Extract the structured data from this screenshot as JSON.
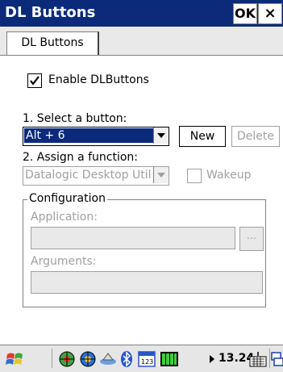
{
  "window": {
    "title": "DL Buttons",
    "ok_label": "OK",
    "close_label": "×"
  },
  "tabs": [
    {
      "label": "DL Buttons"
    }
  ],
  "form": {
    "enable_checkbox": {
      "label": "Enable DLButtons",
      "checked": true
    },
    "select_button_label": "1. Select a button:",
    "selected_button": "Alt + 6",
    "new_label": "New",
    "delete_label": "Delete",
    "assign_function_label": "2. Assign a function:",
    "selected_function": "Datalogic Desktop Utili",
    "wakeup": {
      "label": "Wakeup",
      "checked": false
    },
    "configuration": {
      "title": "Configuration",
      "application_label": "Application:",
      "application_value": "",
      "browse_label": "...",
      "arguments_label": "Arguments:",
      "arguments_value": ""
    }
  },
  "taskbar": {
    "clock": "13.24",
    "icons": [
      "start-windows-icon",
      "network-icon",
      "network-alt-icon",
      "sync-icon",
      "bluetooth-icon",
      "keypad-123-icon",
      "battery-icon",
      "arrow-right-icon",
      "keyboard-icon",
      "windows-switch-icon"
    ]
  },
  "colors": {
    "titlebar": "#0b2a7a",
    "selection": "#0b2a7a",
    "disabled_text": "#a0a0a0"
  }
}
